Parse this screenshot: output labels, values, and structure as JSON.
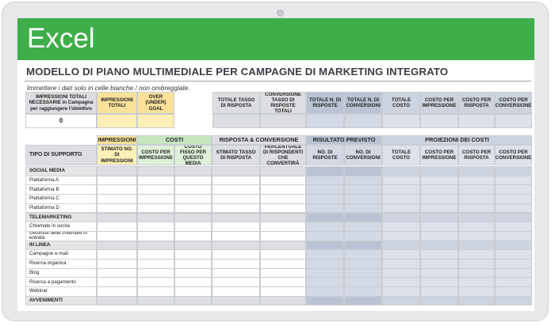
{
  "app": {
    "name": "Excel"
  },
  "sheet": {
    "title": "MODELLO DI PIANO MULTIMEDIALE PER CAMPAGNE DI MARKETING INTEGRATO",
    "instruction": "Immettere i dati solo in celle bianche / non ombreggiate."
  },
  "summary": {
    "headers": {
      "impressioni_tot": "IMPRESSIONI TOTALI NECESSARIE in Campagna per raggiungere l'obiettivo",
      "impressioni_totali": "IMPRESSIONI TOTALI",
      "over_under": "OVER (UNDER) GOAL",
      "tasso_risposta": "TOTALE TASSO DI RISPOSTA",
      "conversione_tasso": "CONVERSIONE TASSO DI RISPOSTE TOTALI",
      "totale_risposte": "TOTALE N. DI RISPOSTE",
      "totale_conversioni": "TOTALE N. DI CONVERSIONI",
      "totale_costo": "TOTALE COSTO",
      "costo_impressione": "COSTO PER IMPRESSIONE",
      "costo_risposta": "COSTO PER RISPOSTA",
      "costo_conversione": "COSTO PER CONVERSIONE"
    },
    "impressioni_value": "0"
  },
  "groups": {
    "impressioni": "IMPRESSIONI",
    "costi": "COSTI",
    "risposta": "RISPOSTA & CONVERSIONE",
    "risultato": "RISULTATO PREVISTO",
    "proiezioni": "PROIEZIONI DEI COSTI"
  },
  "columns": {
    "tipo": "TIPO DI SUPPORTO",
    "stimato_impressioni": "STIMATO NO. DI IMPRESSIONI",
    "costo_impressione": "COSTO PER IMPRESSIONE",
    "costo_fisso": "COSTO FISSO PER QUESTO MEDIA",
    "stimato_tasso": "STIMATO TASSO DI RISPOSTA",
    "percentuale": "PERCENTUALE DI RISPONDENTI CHE CONVERTIRÀ",
    "n_risposte": "NO. DI RISPOSTE",
    "n_conversioni": "NO. DI CONVERSIONI",
    "totale_costo": "TOTALE COSTO",
    "costo_per_impressione": "COSTO PER IMPRESSIONE",
    "costo_per_risposta": "COSTO PER RISPOSTA",
    "costo_per_conversione": "COSTO PER CONVERSIONE"
  },
  "rows": [
    {
      "label": "SOCIAL MEDIA",
      "section": true
    },
    {
      "label": "Piattaforma A",
      "section": false
    },
    {
      "label": "Piattaforma B",
      "section": false
    },
    {
      "label": "Piattaforma C",
      "section": false
    },
    {
      "label": "Piattaforma D",
      "section": false
    },
    {
      "label": "TELEMARKETING",
      "section": true
    },
    {
      "label": "Chiamate in uscita",
      "section": false
    },
    {
      "label": "Gestione delle chiamate in entrata",
      "section": false
    },
    {
      "label": "IN LINEA",
      "section": true
    },
    {
      "label": "Campagne e-mail",
      "section": false
    },
    {
      "label": "Ricerca organica",
      "section": false
    },
    {
      "label": "Blog",
      "section": false
    },
    {
      "label": "Ricerca a pagamento",
      "section": false
    },
    {
      "label": "Webinar",
      "section": false
    },
    {
      "label": "AVVENIMENTI",
      "section": true
    }
  ]
}
